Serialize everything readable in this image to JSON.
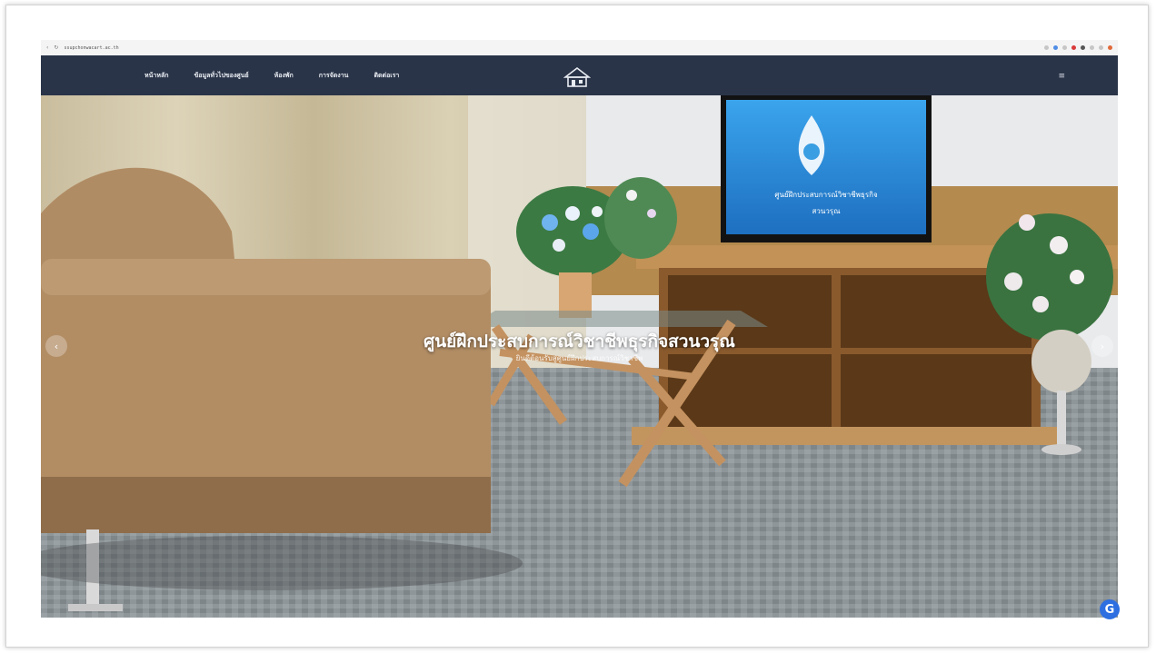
{
  "browser": {
    "url": "ssupchonwacart.ac.th"
  },
  "nav": {
    "items": [
      {
        "label": "หน้าหลัก"
      },
      {
        "label": "ข้อมูลทั่วไปของศูนย์"
      },
      {
        "label": "ห้องพัก"
      },
      {
        "label": "การจัดงาน"
      },
      {
        "label": "ติดต่อเรา"
      }
    ],
    "toggle_label": "≡"
  },
  "hero": {
    "title": "ศูนย์ฝึกประสบการณ์วิชาชีพธุรกิจสวนวรุณ",
    "subtitle": "ยินดีต้อนรับสู่ศูนย์ฝึกประสบการณ์วิชาชีพ",
    "tv_text_line1": "ศูนย์ฝึกประสบการณ์วิชาชีพธุรกิจ",
    "tv_text_line2": "สวนวรุณ"
  },
  "carousel": {
    "prev_label": "‹",
    "next_label": "›"
  },
  "chat_label": "G",
  "colors": {
    "nav_bg": "#2a3448",
    "tv_screen": "#2a8fd8",
    "sofa": "#b08b63",
    "carpet": "#8a9093"
  }
}
